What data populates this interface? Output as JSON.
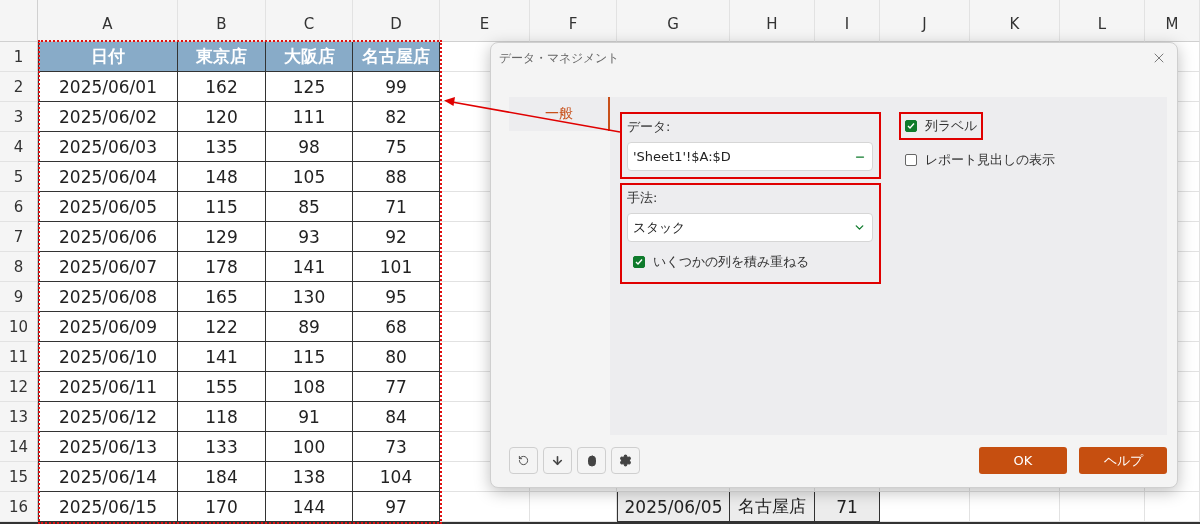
{
  "spreadsheet": {
    "columns": [
      "A",
      "B",
      "C",
      "D",
      "E",
      "F",
      "G",
      "H",
      "I",
      "J",
      "K",
      "L",
      "M"
    ],
    "row_numbers": [
      "1",
      "2",
      "3",
      "4",
      "5",
      "6",
      "7",
      "8",
      "9",
      "10",
      "11",
      "12",
      "13",
      "14",
      "15",
      "16"
    ],
    "table": {
      "headers": [
        "日付",
        "東京店",
        "大阪店",
        "名古屋店"
      ],
      "rows": [
        [
          "2025/06/01",
          "162",
          "125",
          "99"
        ],
        [
          "2025/06/02",
          "120",
          "111",
          "82"
        ],
        [
          "2025/06/03",
          "135",
          "98",
          "75"
        ],
        [
          "2025/06/04",
          "148",
          "105",
          "88"
        ],
        [
          "2025/06/05",
          "115",
          "85",
          "71"
        ],
        [
          "2025/06/06",
          "129",
          "93",
          "92"
        ],
        [
          "2025/06/07",
          "178",
          "141",
          "101"
        ],
        [
          "2025/06/08",
          "165",
          "130",
          "95"
        ],
        [
          "2025/06/09",
          "122",
          "89",
          "68"
        ],
        [
          "2025/06/10",
          "141",
          "115",
          "80"
        ],
        [
          "2025/06/11",
          "155",
          "108",
          "77"
        ],
        [
          "2025/06/12",
          "118",
          "91",
          "84"
        ],
        [
          "2025/06/13",
          "133",
          "100",
          "73"
        ],
        [
          "2025/06/14",
          "184",
          "138",
          "104"
        ],
        [
          "2025/06/15",
          "170",
          "144",
          "97"
        ]
      ]
    },
    "row_16_visible_cells": [
      "2025/06/05",
      "名古屋店",
      "71"
    ]
  },
  "dialog": {
    "title": "データ・マネジメント",
    "tabs": [
      {
        "label": "一般",
        "selected": true
      }
    ],
    "data_group": {
      "highlighted": true,
      "label": "データ:",
      "value": "'Sheet1'!$A:$D"
    },
    "method_group": {
      "highlighted": true,
      "label": "手法:",
      "value": "スタック",
      "checkbox": {
        "label": "いくつかの列を積み重ねる",
        "checked": true
      }
    },
    "options": [
      {
        "label": "列ラベル",
        "checked": true,
        "highlighted": true
      },
      {
        "label": "レポート見出しの表示",
        "checked": false
      }
    ],
    "buttons": [
      {
        "label": "OK"
      },
      {
        "label": "ヘルプ"
      }
    ]
  }
}
